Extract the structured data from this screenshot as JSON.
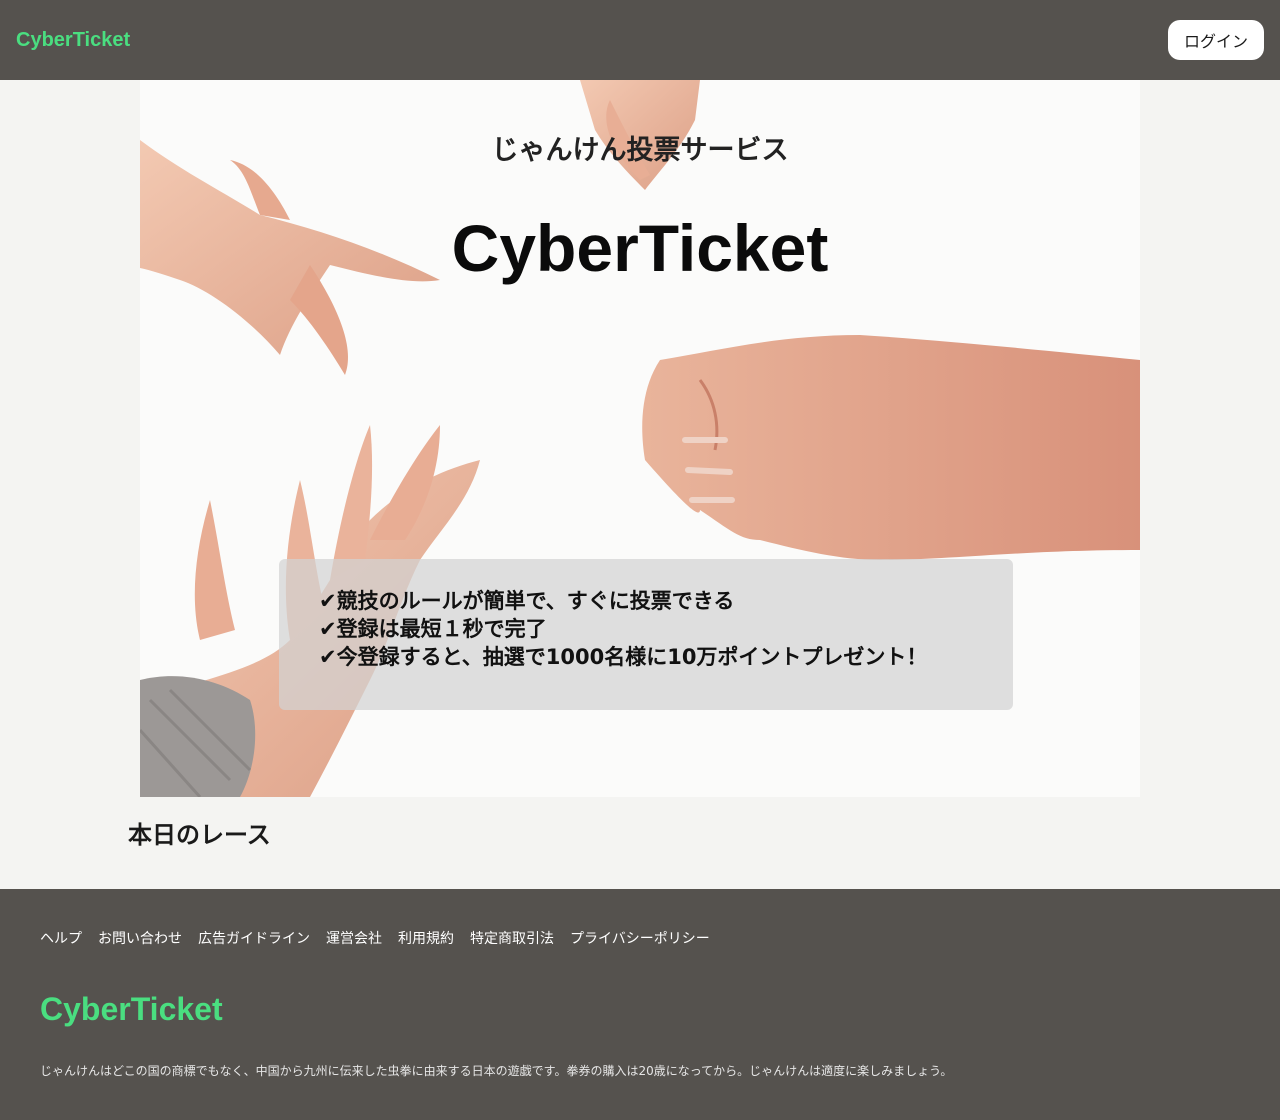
{
  "header": {
    "brand": "CyberTicket",
    "login_label": "ログイン"
  },
  "hero": {
    "subtitle": "じゃんけん投票サービス",
    "title": "CyberTicket",
    "features": [
      "✔競技のルールが簡単で、すぐに投票できる",
      "✔登録は最短１秒で完了",
      "✔今登録すると、抽選で1000名様に10万ポイントプレゼント！"
    ]
  },
  "main": {
    "section_title": "本日のレース"
  },
  "footer": {
    "links": [
      "ヘルプ",
      "お問い合わせ",
      "広告ガイドライン",
      "運営会社",
      "利用規約",
      "特定商取引法",
      "プライバシーポリシー"
    ],
    "brand": "CyberTicket",
    "note": "じゃんけんはどこの国の商標でもなく、中国から九州に伝来した虫拳に由来する日本の遊戯です。拳券の購入は20歳になってから。じゃんけんは適度に楽しみましょう。"
  },
  "colors": {
    "header_bg": "#55524e",
    "brand": "#4ade80",
    "page_bg": "#f4f4f2"
  }
}
